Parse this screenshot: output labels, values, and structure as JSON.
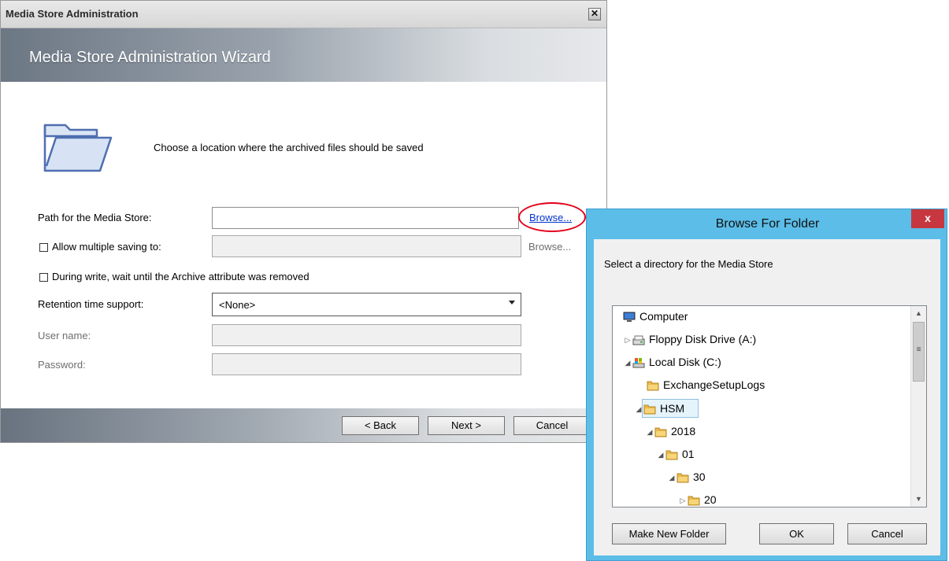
{
  "wizard": {
    "window_title": "Media Store Administration",
    "close_glyph": "✕",
    "heading": "Media Store Administration Wizard",
    "intro": "Choose a location where the archived files should be saved",
    "path_label": "Path for the Media Store:",
    "path_value": "",
    "browse_label": "Browse...",
    "multi_label": "Allow multiple saving to:",
    "multi_checked": false,
    "multi_browse_label": "Browse...",
    "archive_label": "During write, wait until the Archive attribute was removed",
    "archive_checked": false,
    "retention_label": "Retention time support:",
    "retention_value": "<None>",
    "username_label": "User name:",
    "password_label": "Password:",
    "back_label": "< Back",
    "next_label": "Next >",
    "cancel_label": "Cancel"
  },
  "browse_dialog": {
    "title": "Browse For Folder",
    "close_glyph": "x",
    "instruction": "Select a directory for the Media Store",
    "tree": [
      {
        "label": "Computer",
        "icon": "computer-icon",
        "toggle": ""
      },
      {
        "label": "Floppy Disk Drive (A:)",
        "icon": "floppy-drive-icon",
        "toggle": "▷"
      },
      {
        "label": "Local Disk (C:)",
        "icon": "local-disk-icon",
        "toggle": "◢"
      },
      {
        "label": "ExchangeSetupLogs",
        "icon": "folder-icon",
        "toggle": ""
      },
      {
        "label": "HSM",
        "icon": "folder-icon",
        "toggle": "◢",
        "selected": true
      },
      {
        "label": "2018",
        "icon": "folder-icon",
        "toggle": "◢"
      },
      {
        "label": "01",
        "icon": "folder-icon",
        "toggle": "◢"
      },
      {
        "label": "30",
        "icon": "folder-icon",
        "toggle": "◢"
      },
      {
        "label": "20",
        "icon": "folder-icon",
        "toggle": "▷"
      }
    ],
    "make_new_folder_label": "Make New Folder",
    "ok_label": "OK",
    "cancel_label": "Cancel"
  },
  "colors": {
    "link": "#0033cc",
    "annotation_circle": "#e2001a",
    "dialog_frame": "#5bbde8",
    "dialog_close": "#c7373f",
    "selection": "#e5f3fb"
  }
}
